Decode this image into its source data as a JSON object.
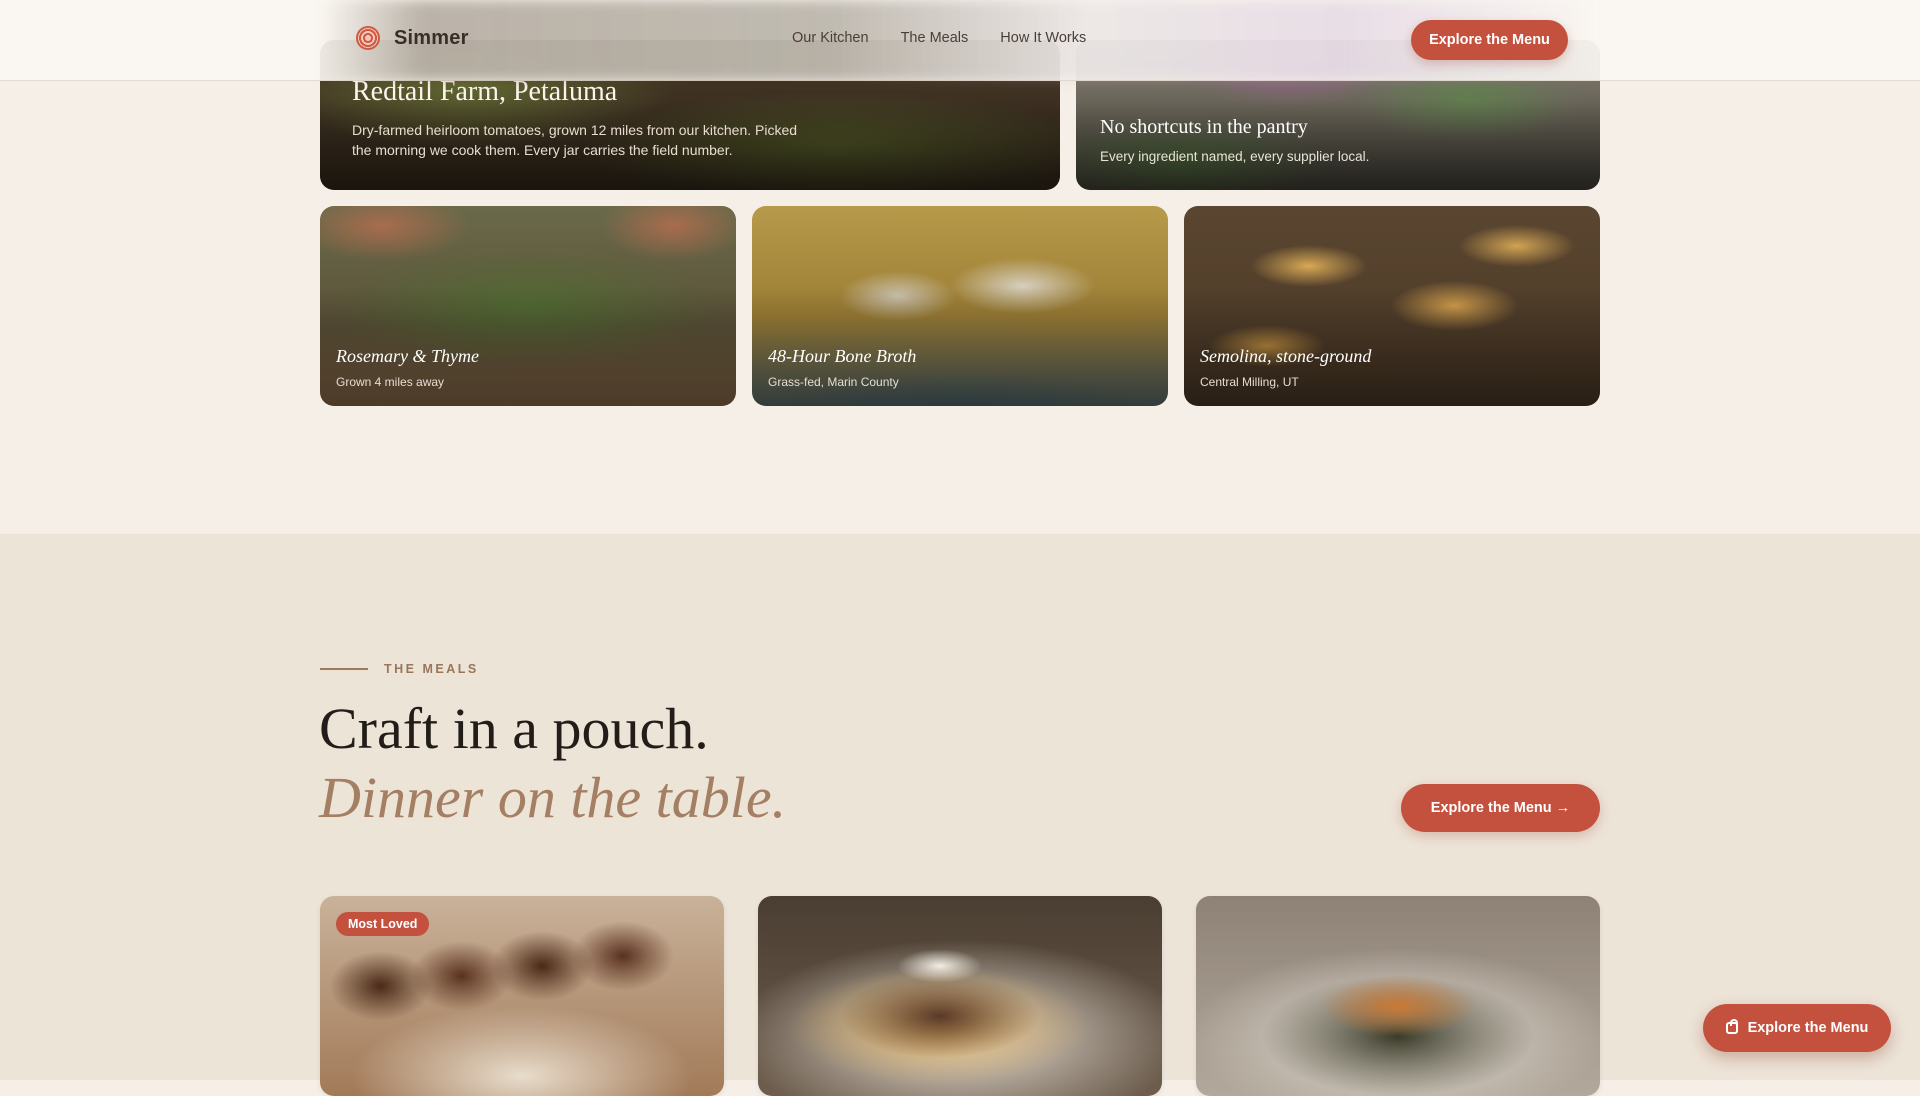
{
  "header": {
    "brand": "Simmer",
    "nav": [
      "Our Kitchen",
      "The Meals",
      "How It Works"
    ],
    "cta": "Explore the Menu"
  },
  "feature_cards": {
    "farm": {
      "title": "Redtail Farm, Petaluma",
      "desc": "Dry-farmed heirloom tomatoes, grown 12 miles from our kitchen. Picked the morning we cook them. Every jar carries the field number."
    },
    "pantry": {
      "title": "No shortcuts in the pantry",
      "desc": "Every ingredient named, every supplier local."
    }
  },
  "ingredient_cards": [
    {
      "title": "Rosemary & Thyme",
      "sub": "Grown 4 miles away"
    },
    {
      "title": "48-Hour Bone Broth",
      "sub": "Grass-fed, Marin County"
    },
    {
      "title": "Semolina, stone-ground",
      "sub": "Central Milling, UT"
    }
  ],
  "meals": {
    "eyebrow": "THE MEALS",
    "headline_1": "Craft in a pouch.",
    "headline_2": "Dinner on the table.",
    "cta": "Explore the Menu →",
    "badge": "Most Loved"
  },
  "floating_cta": {
    "label": "Explore the Menu",
    "icon": "shopping-bag-icon"
  },
  "colors": {
    "accent": "#c4513e",
    "background": "#f6efe7",
    "section": "#ede4d8",
    "muted_serif": "#a47f63"
  }
}
